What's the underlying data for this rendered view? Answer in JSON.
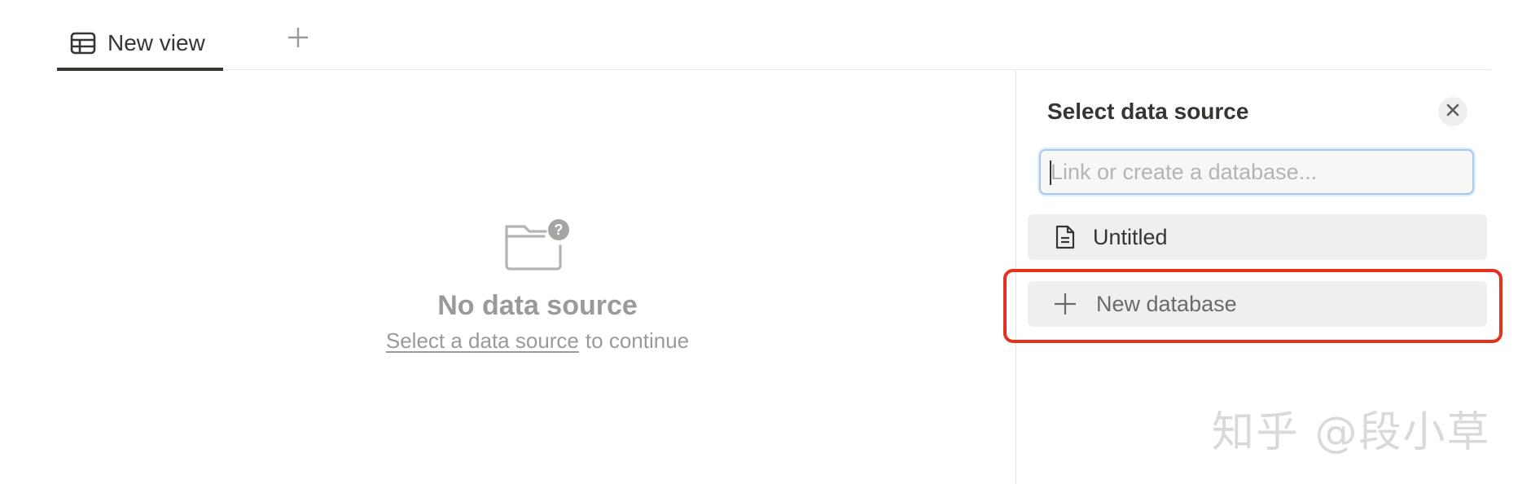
{
  "tabs": [
    {
      "label": "New view",
      "icon": "table-icon",
      "active": true
    }
  ],
  "add_view_icon": "plus-icon",
  "empty_state": {
    "icon": "folder-question-icon",
    "title": "No data source",
    "link_text": "Select a data source",
    "rest_text": "to continue"
  },
  "panel": {
    "title": "Select data source",
    "close_icon": "close-icon",
    "search": {
      "placeholder": "Link or create a database...",
      "value": ""
    },
    "items": [
      {
        "label": "Untitled",
        "icon": "page-icon"
      },
      {
        "label": "New database",
        "icon": "plus-icon"
      }
    ]
  },
  "highlight_color": "#e3321e",
  "watermark": "知乎 @段小草"
}
